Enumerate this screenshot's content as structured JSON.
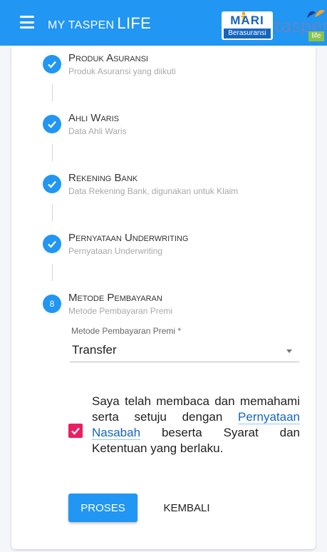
{
  "header": {
    "title_prefix": "MY TASPEN",
    "title_suffix": "LIFE",
    "logo_mari": "MARI",
    "logo_mari_sub": "Berasuransi",
    "logo_taspen": "taspen",
    "logo_taspen_sub": "life",
    "background_color": "#2196f3"
  },
  "steps": [
    {
      "title": "Produk Asuransi",
      "subtitle": "Produk Asuransi yang diikuti",
      "status": "done",
      "icon": "check-icon"
    },
    {
      "title": "Ahli Waris",
      "subtitle": "Data Ahli Waris",
      "status": "done",
      "icon": "check-icon"
    },
    {
      "title": "Rekening Bank",
      "subtitle": "Data Rekening Bank, digunakan untuk Klaim",
      "status": "done",
      "icon": "check-icon"
    },
    {
      "title": "Pernyataan Underwriting",
      "subtitle": "Pernyataan Underwriting",
      "status": "done",
      "icon": "check-icon"
    },
    {
      "title": "Metode Pembayaran",
      "subtitle": "Metode Pembayaran Premi",
      "status": "active",
      "number": "8"
    }
  ],
  "payment": {
    "label": "Metode Pembayaran Premi *",
    "selected": "Transfer"
  },
  "agreement": {
    "checked": true,
    "text_before": "Saya telah membaca dan memahami serta setuju dengan ",
    "link_text": "Pernyataan Nasabah",
    "text_after": " beserta Syarat dan Ketentuan yang berlaku."
  },
  "actions": {
    "proses_label": "PROSES",
    "kembali_label": "KEMBALI"
  },
  "colors": {
    "accent": "#2196f3",
    "checkbox": "#e91e63",
    "link": "#1565c0"
  }
}
